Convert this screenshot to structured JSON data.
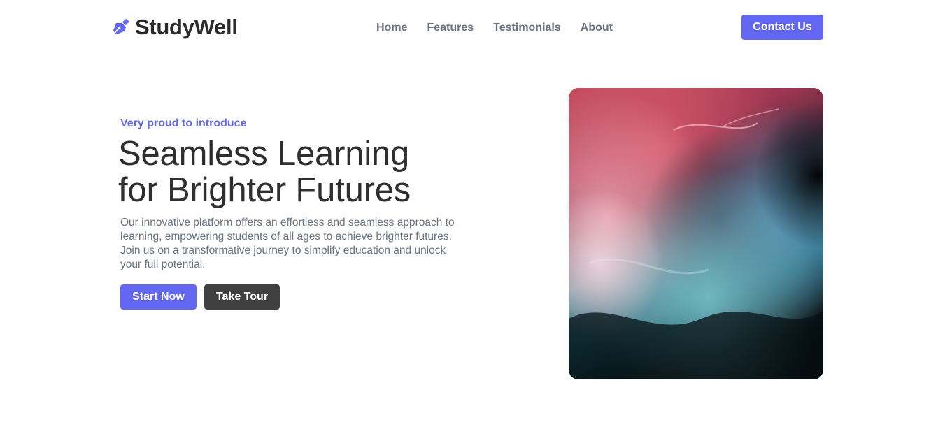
{
  "brand": {
    "name": "StudyWell",
    "icon": "fountain-pen-icon",
    "accent_color": "#6366f1"
  },
  "nav": {
    "items": [
      {
        "label": "Home"
      },
      {
        "label": "Features"
      },
      {
        "label": "Testimonials"
      },
      {
        "label": "About"
      }
    ]
  },
  "header": {
    "contact_label": "Contact Us"
  },
  "hero": {
    "eyebrow": "Very proud to introduce",
    "title_line1": "Seamless Learning",
    "title_line2": "for Brighter Futures",
    "description": "Our innovative platform offers an effortless and seamless approach to learning, empowering students of all ages to achieve brighter futures. Join us on a transformative journey to simplify education and unlock your full potential.",
    "primary_cta": "Start Now",
    "secondary_cta": "Take Tour",
    "secondary_color": "#404040",
    "text_color": "#2f2f2f",
    "muted_color": "#6b7280"
  }
}
